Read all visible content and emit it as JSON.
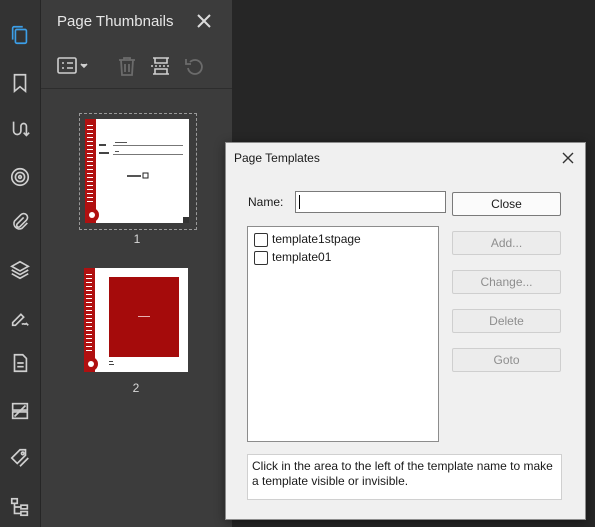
{
  "thumbnails_panel": {
    "title": "Page Thumbnails",
    "pages": [
      {
        "number": "1"
      },
      {
        "number": "2"
      }
    ]
  },
  "left_toolbar": {
    "icons": [
      "pages-icon",
      "bookmark-icon",
      "link-path-icon",
      "target-icon",
      "attachment-icon",
      "layers-icon",
      "signature-icon",
      "document-icon",
      "compare-icon",
      "tag-icon",
      "structure-icon"
    ]
  },
  "dialog": {
    "title": "Page Templates",
    "name_label": "Name:",
    "name_value": "",
    "templates": [
      {
        "label": "template1stpage",
        "checked": false
      },
      {
        "label": "template01",
        "checked": false
      }
    ],
    "buttons": {
      "close": "Close",
      "add": "Add...",
      "change": "Change...",
      "delete": "Delete",
      "goto": "Goto"
    },
    "info": "Click in the area to the left of the template name to make a template visible or invisible."
  },
  "colors": {
    "accent_blue": "#3c9fe8",
    "sidebar_bg": "#333333",
    "panel_bg": "#3c3c3c",
    "dialog_bg": "#f0f0f0",
    "page_red": "#b01010"
  }
}
